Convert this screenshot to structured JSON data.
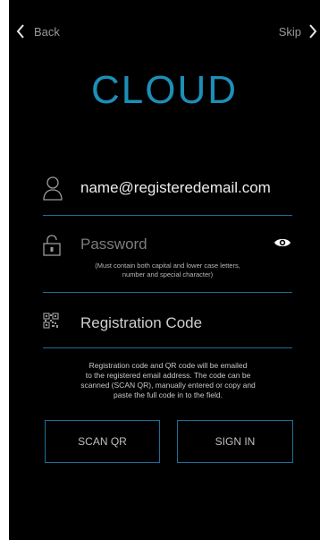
{
  "topbar": {
    "back_label": "Back",
    "skip_label": "Skip",
    "back_icon": "chevron-left-icon",
    "skip_icon": "chevron-right-icon"
  },
  "app": {
    "title": "CLOUD"
  },
  "form": {
    "email": {
      "value": "name@registeredemail.com",
      "icon": "user-icon"
    },
    "password": {
      "placeholder": "Password",
      "icon": "lock-icon",
      "toggle_icon": "eye-icon",
      "hint_line1": "(Must contain both capital and lower case letters,",
      "hint_line2": "number and special character)"
    },
    "registration_code": {
      "placeholder": "Registration Code",
      "icon": "qr-code-icon"
    },
    "info_line1": "Registration code and QR code will be emailed",
    "info_line2": "to the registered email address. The code can be",
    "info_line3": "scanned (SCAN QR), manually entered or copy and",
    "info_line4": "paste the full code in to the field."
  },
  "buttons": {
    "scan_qr": "SCAN QR",
    "sign_in": "SIGN IN"
  },
  "colors": {
    "accent": "#1c8fb8",
    "underline": "#1f6f95",
    "background": "#000000"
  }
}
